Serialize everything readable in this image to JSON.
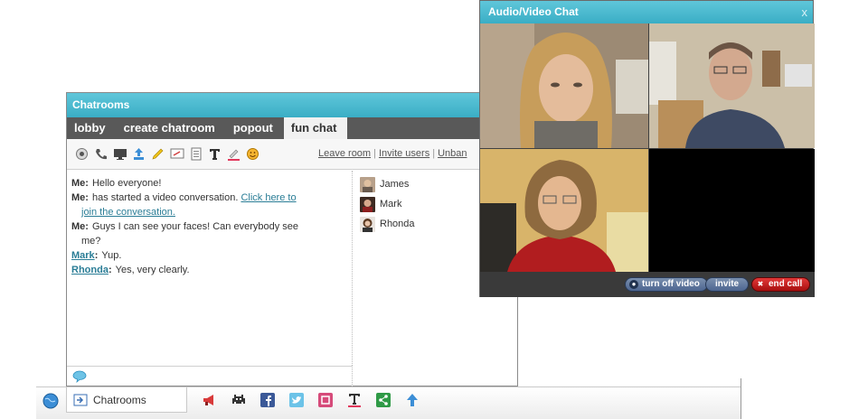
{
  "chatrooms": {
    "title": "Chatrooms",
    "tabs": [
      {
        "label": "lobby"
      },
      {
        "label": "create chatroom"
      },
      {
        "label": "popout"
      },
      {
        "label": "fun chat"
      }
    ],
    "toolbar_icons": [
      "webcam-icon",
      "phone-icon",
      "screen-share-icon",
      "upload-icon",
      "pencil-icon",
      "whiteboard-icon",
      "notes-icon",
      "text-icon",
      "color-picker-icon",
      "smiley-icon"
    ],
    "links": {
      "leave": "Leave room",
      "invite": "Invite users",
      "unban": "Unban"
    },
    "messages": [
      {
        "who": "Me:",
        "text": "Hello everyone!"
      },
      {
        "who": "Me:",
        "text": "has started a video conversation. ",
        "link1": "Click here to",
        "link2": "join the conversation."
      },
      {
        "who": "Me:",
        "text": "Guys I can see your faces! Can everybody see",
        "text2": "me?"
      },
      {
        "who": "Mark",
        "colon": ":",
        "text": "Yup."
      },
      {
        "who": "Rhonda",
        "colon": ":",
        "text": "Yes, very clearly."
      }
    ],
    "users": [
      {
        "name": "James"
      },
      {
        "name": "Mark"
      },
      {
        "name": "Rhonda"
      }
    ]
  },
  "bottombar": {
    "chatrooms_label": "Chatrooms",
    "icons": [
      "announcement-icon",
      "games-icon",
      "facebook-icon",
      "twitter-icon",
      "store-icon",
      "translate-icon",
      "share-icon",
      "scroll-top-icon"
    ]
  },
  "avchat": {
    "title": "Audio/Video Chat",
    "close": "x",
    "turn_off_video": "turn off video",
    "invite": "invite",
    "end_call": "end call"
  }
}
